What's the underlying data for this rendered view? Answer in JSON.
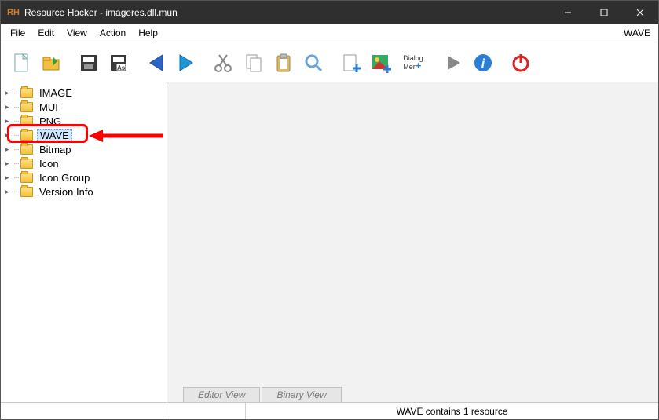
{
  "title": "Resource Hacker - imageres.dll.mun",
  "logo_text": "RH",
  "menu": {
    "file": "File",
    "edit": "Edit",
    "view": "View",
    "action": "Action",
    "help": "Help",
    "context": "WAVE"
  },
  "toolbar": {
    "new": "new",
    "open": "open",
    "save": "save",
    "saveas": "saveas",
    "back": "back",
    "forward": "forward",
    "cut": "cut",
    "copy": "copy",
    "paste": "paste",
    "find": "find",
    "addres": "addres",
    "addimg": "addimg",
    "dialog": "Dialog Mer",
    "play": "play",
    "info": "info",
    "power": "power"
  },
  "tree": {
    "items": [
      {
        "label": "IMAGE",
        "selected": false
      },
      {
        "label": "MUI",
        "selected": false
      },
      {
        "label": "PNG",
        "selected": false
      },
      {
        "label": "WAVE",
        "selected": true
      },
      {
        "label": "Bitmap",
        "selected": false
      },
      {
        "label": "Icon",
        "selected": false
      },
      {
        "label": "Icon Group",
        "selected": false
      },
      {
        "label": "Version Info",
        "selected": false
      }
    ]
  },
  "tabs": {
    "editor": "Editor View",
    "binary": "Binary View"
  },
  "status": "WAVE contains 1 resource"
}
